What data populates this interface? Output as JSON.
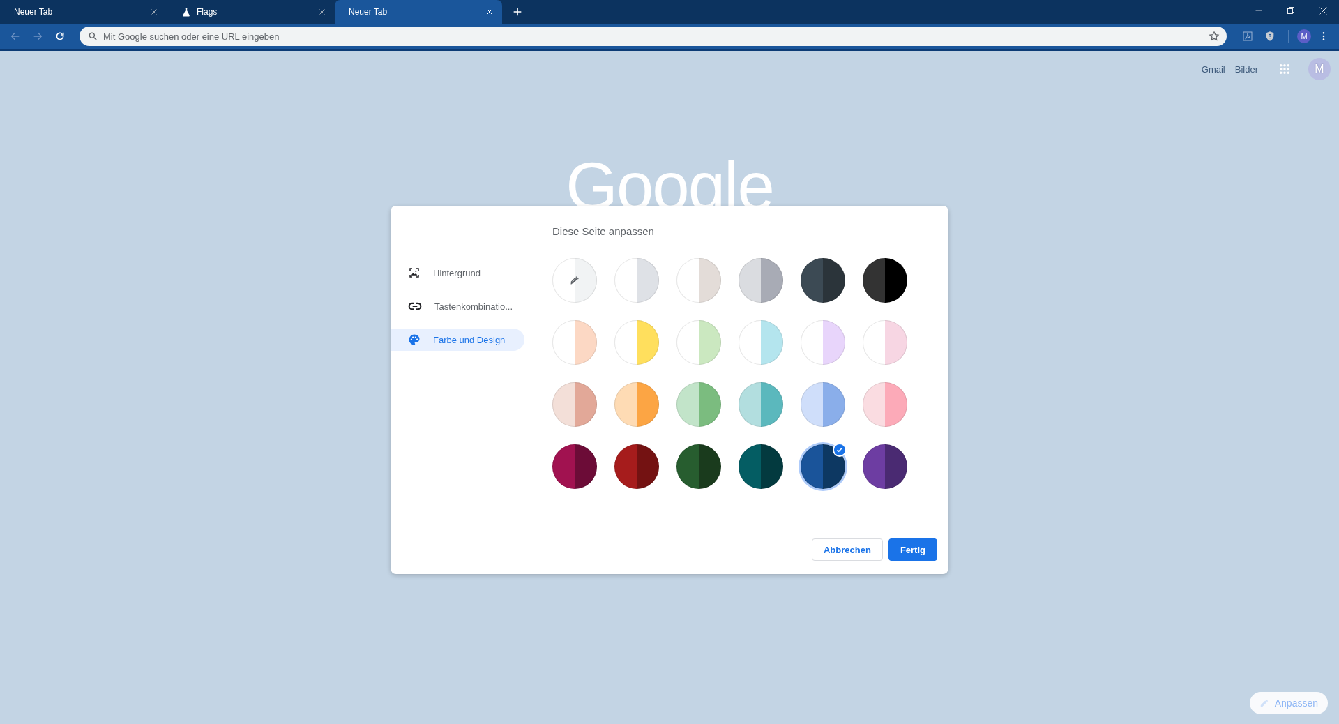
{
  "tabs": [
    {
      "title": "Neuer Tab",
      "selected": false,
      "kind": "plain"
    },
    {
      "title": "Flags",
      "selected": false,
      "kind": "flask"
    },
    {
      "title": "Neuer Tab",
      "selected": true,
      "kind": "plain"
    }
  ],
  "toolbar": {
    "address": {
      "placeholder": "Mit Google suchen oder eine URL eingeben"
    },
    "profile": "M"
  },
  "header": {
    "links": [
      "Gmail",
      "Bilder"
    ],
    "avatar": "M"
  },
  "logo": "Google",
  "dialog": {
    "title": "Diese Seite anpassen",
    "nav": [
      {
        "label": "Hintergrund",
        "selected": false
      },
      {
        "label": "Tastenkombinatio...",
        "selected": false
      },
      {
        "label": "Farbe und Design",
        "selected": true
      }
    ],
    "swatches": [
      {
        "kind": "custom",
        "halves": [
          {
            "color": "#ffffff"
          },
          {
            "color": "#f1f3f4"
          }
        ],
        "selected": false
      },
      {
        "kind": "preset",
        "halves": [
          {
            "color": "#ffffff"
          },
          {
            "color": "#dee1e6"
          }
        ],
        "selected": false
      },
      {
        "kind": "preset",
        "halves": [
          {
            "color": "#ffffff"
          },
          {
            "color": "#e3dcd8"
          }
        ],
        "selected": false
      },
      {
        "kind": "preset",
        "halves": [
          {
            "color": "#dadce0"
          },
          {
            "color": "#a8abb5"
          }
        ],
        "selected": false
      },
      {
        "kind": "preset",
        "halves": [
          {
            "color": "#3c4a54"
          },
          {
            "color": "#2b343a"
          }
        ],
        "selected": false
      },
      {
        "kind": "preset",
        "halves": [
          {
            "color": "#333333"
          },
          {
            "color": "#000000"
          }
        ],
        "selected": false
      },
      {
        "kind": "preset",
        "halves": [
          {
            "color": "#ffffff"
          },
          {
            "color": "#fcd8c4"
          }
        ],
        "selected": false
      },
      {
        "kind": "preset",
        "halves": [
          {
            "color": "#ffffff"
          },
          {
            "color": "#ffdf5d"
          }
        ],
        "selected": false
      },
      {
        "kind": "preset",
        "halves": [
          {
            "color": "#ffffff"
          },
          {
            "color": "#cbe8c0"
          }
        ],
        "selected": false
      },
      {
        "kind": "preset",
        "halves": [
          {
            "color": "#ffffff"
          },
          {
            "color": "#b4e5ee"
          }
        ],
        "selected": false
      },
      {
        "kind": "preset",
        "halves": [
          {
            "color": "#ffffff"
          },
          {
            "color": "#e8d5fb"
          }
        ],
        "selected": false
      },
      {
        "kind": "preset",
        "halves": [
          {
            "color": "#ffffff"
          },
          {
            "color": "#f7d6e3"
          }
        ],
        "selected": false
      },
      {
        "kind": "preset",
        "halves": [
          {
            "color": "#f3dfd8"
          },
          {
            "color": "#e2a898"
          }
        ],
        "selected": false
      },
      {
        "kind": "preset",
        "halves": [
          {
            "color": "#fedbb4"
          },
          {
            "color": "#fca544"
          }
        ],
        "selected": false
      },
      {
        "kind": "preset",
        "halves": [
          {
            "color": "#c2e4c9"
          },
          {
            "color": "#7bbc7f"
          }
        ],
        "selected": false
      },
      {
        "kind": "preset",
        "halves": [
          {
            "color": "#b2dedf"
          },
          {
            "color": "#5bb8bd"
          }
        ],
        "selected": false
      },
      {
        "kind": "preset",
        "halves": [
          {
            "color": "#cfdefa"
          },
          {
            "color": "#8aaeea"
          }
        ],
        "selected": false
      },
      {
        "kind": "preset",
        "halves": [
          {
            "color": "#fadce1"
          },
          {
            "color": "#fcaab8"
          }
        ],
        "selected": false
      },
      {
        "kind": "preset",
        "halves": [
          {
            "color": "#a11250"
          },
          {
            "color": "#6c0c37"
          }
        ],
        "selected": false
      },
      {
        "kind": "preset",
        "halves": [
          {
            "color": "#a61c1c"
          },
          {
            "color": "#741212"
          }
        ],
        "selected": false
      },
      {
        "kind": "preset",
        "halves": [
          {
            "color": "#275d2f"
          },
          {
            "color": "#1a3b1d"
          }
        ],
        "selected": false
      },
      {
        "kind": "preset",
        "halves": [
          {
            "color": "#045d63"
          },
          {
            "color": "#033a3f"
          }
        ],
        "selected": false
      },
      {
        "kind": "preset",
        "halves": [
          {
            "color": "#1a549a"
          },
          {
            "color": "#0d3862"
          }
        ],
        "selected": true
      },
      {
        "kind": "preset",
        "halves": [
          {
            "color": "#6d3da2"
          },
          {
            "color": "#4a2a72"
          }
        ],
        "selected": false
      }
    ],
    "buttons": {
      "cancel": "Abbrechen",
      "done": "Fertig"
    }
  },
  "customize": "Anpassen"
}
